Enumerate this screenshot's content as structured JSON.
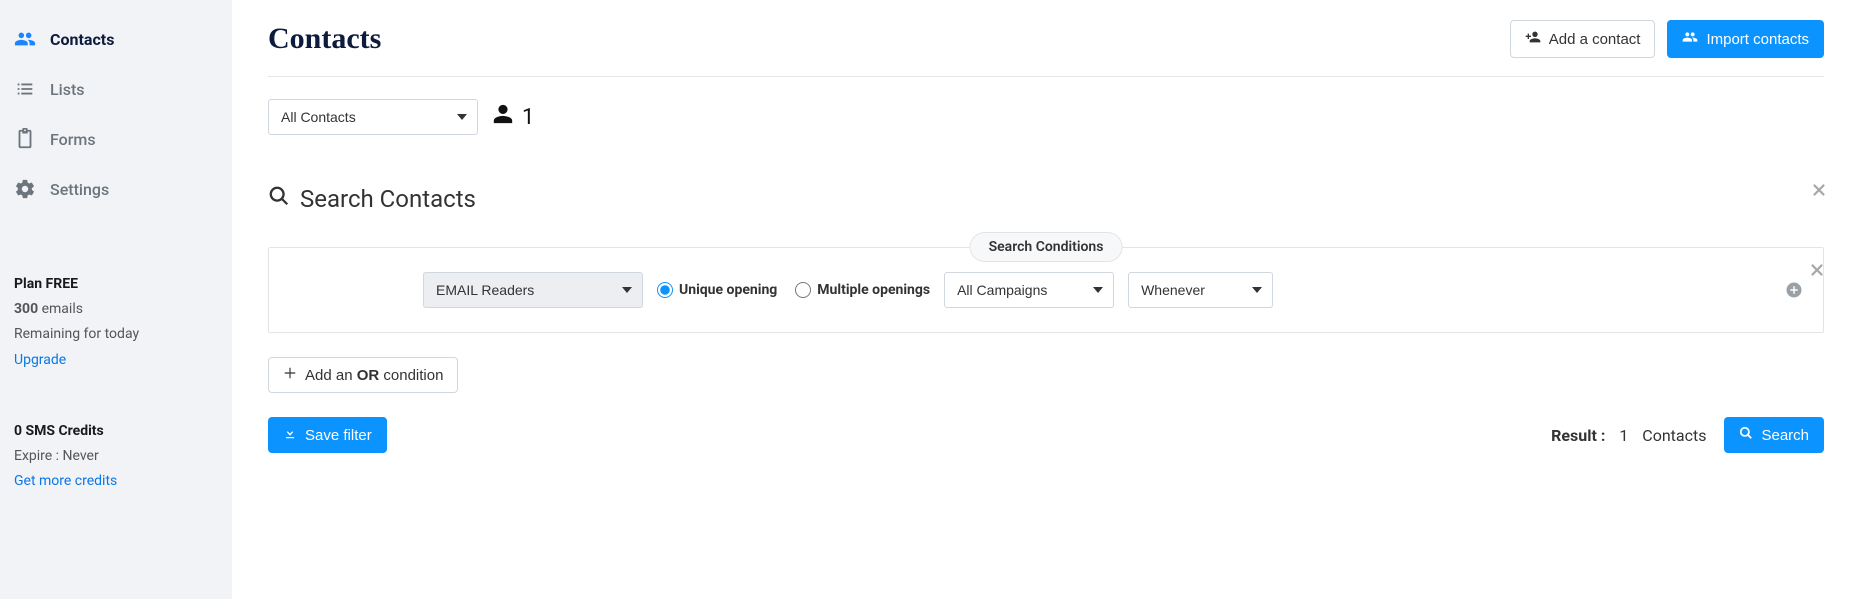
{
  "sidebar": {
    "items": [
      {
        "label": "Contacts"
      },
      {
        "label": "Lists"
      },
      {
        "label": "Forms"
      },
      {
        "label": "Settings"
      }
    ],
    "plan": {
      "title": "Plan FREE",
      "emails_count": "300",
      "emails_word": "emails",
      "remaining": "Remaining for today",
      "upgrade": "Upgrade"
    },
    "sms": {
      "title": "0 SMS Credits",
      "expire": "Expire : Never",
      "get_more": "Get more credits"
    }
  },
  "header": {
    "title": "Contacts",
    "add_contact": "Add a contact",
    "import_contacts": "Import contacts"
  },
  "filter": {
    "all_contacts_select": "All Contacts",
    "count": "1"
  },
  "search": {
    "title": "Search Contacts",
    "conditions_badge": "Search Conditions",
    "attribute_select": "EMAIL Readers",
    "radio_unique": "Unique opening",
    "radio_multiple": "Multiple openings",
    "campaigns_select": "All Campaigns",
    "time_select": "Whenever",
    "add_or_pre": "Add an ",
    "add_or_bold": "OR",
    "add_or_post": " condition",
    "save_filter": "Save filter",
    "result_label": "Result :",
    "result_count": "1",
    "result_unit": "Contacts",
    "search_btn": "Search"
  }
}
